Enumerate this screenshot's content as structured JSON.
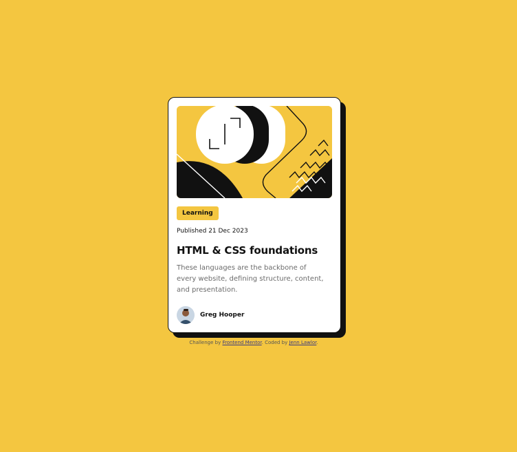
{
  "card": {
    "tag": "Learning",
    "published": "Published 21 Dec 2023",
    "title": "HTML & CSS foundations",
    "description": "These languages are the backbone of every website, defining structure, content, and presentation.",
    "author": {
      "name": "Greg Hooper"
    }
  },
  "attribution": {
    "prefix": "Challenge by ",
    "link1": "Frontend Mentor",
    "middle": ". Coded by ",
    "link2": "Jenn Lawlor",
    "suffix": "."
  },
  "colors": {
    "background": "#F4C640",
    "card": "#FFFFFF",
    "ink": "#111111",
    "muted": "#6B6B6B"
  },
  "icons": [
    "hero-illustration",
    "author-avatar"
  ]
}
